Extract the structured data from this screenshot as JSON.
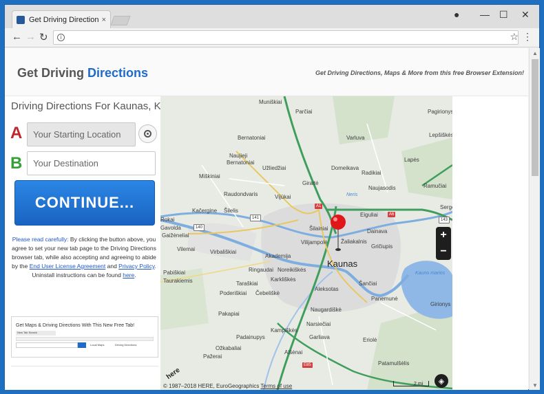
{
  "browser": {
    "tab_title": "Get Driving Directions W",
    "tab_close": "×",
    "address": ""
  },
  "header": {
    "brand_plain": "Get Driving",
    "brand_accent": "Directions",
    "tagline": "Get Driving Directions, Maps & More from this free Browser Extension!"
  },
  "form": {
    "title": "Driving Directions For Kaunas, KU",
    "letter_a": "A",
    "letter_b": "B",
    "start_placeholder": "Your Starting Location",
    "destination_placeholder": "Your Destination",
    "continue_label": "CONTINUE..."
  },
  "disclaimer": {
    "lead": "Please read carefully:",
    "text1": " By clicking the button above, you agree to set your new tab page to the Driving Directions browser tab, while also accepting and agreeing to abide by the ",
    "eula": "End User License Agreement",
    "and": " and ",
    "privacy": "Privacy Policy",
    "text2": ". Uninstall instructions can be found ",
    "here": "here",
    "end": "."
  },
  "promo": {
    "text": "Get Maps & Driving Directions With This New Free Tab!",
    "tab_label": "New Tab Search",
    "item_local_maps": "Local Maps",
    "item_driving": "Driving Directions"
  },
  "map": {
    "city": "Kaunas",
    "labels": {
      "muniskiai": "Muniškiai",
      "parciai": "Parčiai",
      "pagirioniai": "Pagirionys",
      "bernatoniai": "Bernatoniai",
      "varluva": "Varluva",
      "lepsiskes": "Lepšiškės",
      "naujieji": "Naujieji",
      "bernatoniai2": "Bernatoniai",
      "uzliedziai": "Užliedžiai",
      "domeikava": "Domeikava",
      "radikiai": "Radikiai",
      "lapes": "Lapės",
      "miskiniai": "Miškiniai",
      "giraite": "Giraitė",
      "naujasodis": "Naujasodis",
      "ramuciai": "Ramučiai",
      "raudondvaris": "Raudondvaris",
      "vijukai": "Vijūkai",
      "kacergine": "Kačergine",
      "silelis": "Šilelis",
      "eiguliai": "Eiguliai",
      "sergeiciai": "Serge",
      "rokai": "Rokai",
      "silainiai": "Šilainiai",
      "dainava": "Dainava",
      "gavolda": "Gavolda",
      "galzeneliai": "Gaižėneliai",
      "viliampole": "Vilijampolė",
      "zaliakalnis": "Žaliakalnis",
      "griciupis": "Gričiupis",
      "vilemai": "Vilemai",
      "virbaliskiai": "Virbališkiai",
      "akademija": "Akademija",
      "ringaudai": "Ringaudai",
      "noreikiskes": "Noreikiškės",
      "pabiskiai": "Pabiškiai",
      "taurakiemis": "Taurakiemis",
      "karkliskes": "Karkliškės",
      "tarskiai": "Taraškiai",
      "podeskiai": "Poderiškiai",
      "cebeliskes": "Čebeliškė",
      "aleksotas": "Aleksotas",
      "sanciai": "Šančiai",
      "panemune": "Panemunė",
      "girionys": "Girionys",
      "naugardiske": "Naugardiškė",
      "pakapiai": "Pakapiai",
      "narsieciai": "Narsiečiai",
      "kampiskes": "Kampiškės",
      "garliava": "Garliava",
      "padainupys": "Padainupys",
      "ozkabaliai": "Ožkabaliai",
      "eriole": "Eriolė",
      "pazerai": "Pažerai",
      "alsenai": "Alšėnai",
      "patamulsele": "Patamulšėlis",
      "kauno_marios": "Kauno marios",
      "neris": "Neris"
    },
    "shields": {
      "a1": "A1",
      "a6": "A6",
      "e85": "E85",
      "s141": "141",
      "s140": "140",
      "s143": "143"
    },
    "zoom_in": "+",
    "zoom_out": "−",
    "scale": "2 mi",
    "copyright": "© 1987–2018 HERE, EuroGeographics",
    "terms": "Terms of use",
    "here_logo": "here",
    "pin_color": "#e0161b"
  }
}
